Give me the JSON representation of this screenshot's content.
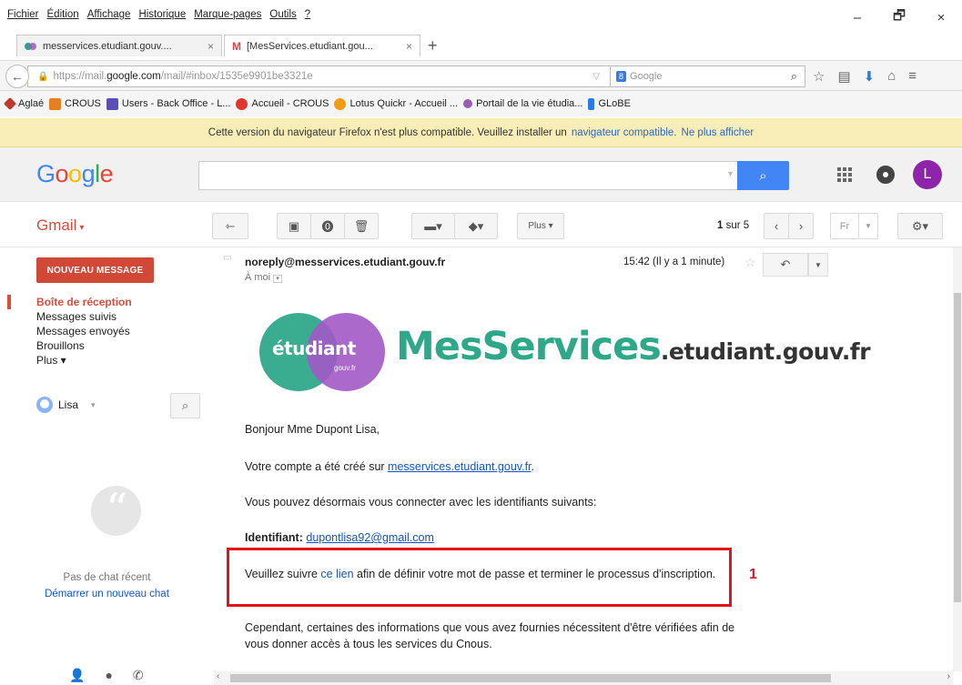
{
  "menu": {
    "items": [
      "Fichier",
      "Édition",
      "Affichage",
      "Historique",
      "Marque-pages",
      "Outils",
      "?"
    ]
  },
  "window_controls": {
    "minimize": "–",
    "restore": "🗗",
    "close": "×"
  },
  "tabs": [
    {
      "label": "messervices.etudiant.gouv....",
      "close": "×"
    },
    {
      "label": "[MesServices.etudiant.gou...",
      "close": "×"
    }
  ],
  "newtab": "+",
  "navbar": {
    "back": "←",
    "url_prefix": "https://mail.",
    "url_domain": "google.com",
    "url_path": "/mail/#inbox/1535e9901be3321e",
    "search_engine": "Google",
    "search_icon": "⌕"
  },
  "bookmarks": [
    {
      "label": "Aglaé",
      "color": "#c0392b"
    },
    {
      "label": "CROUS",
      "color": "#e67e22"
    },
    {
      "label": "Users - Back Office - L...",
      "color": "#5b4fb7"
    },
    {
      "label": "Accueil - CROUS",
      "color": "#e0352b"
    },
    {
      "label": "Lotus Quickr - Accueil ...",
      "color": "#f39c12"
    },
    {
      "label": "Portail de la vie étudia...",
      "color": "#9b59b6"
    },
    {
      "label": "GLoBE",
      "color": "#2c7be5"
    }
  ],
  "warning": {
    "text": "Cette version du navigateur Firefox n'est plus compatible. Veuillez installer un",
    "link1": "navigateur compatible.",
    "link2": "Ne plus afficher"
  },
  "google": {
    "logo": [
      "G",
      "o",
      "o",
      "g",
      "l",
      "e"
    ],
    "avatar_letter": "L",
    "search_btn": "⌕"
  },
  "gmail": {
    "label": "Gmail",
    "caret": "▾",
    "more_label": "Plus",
    "pager_current": "1",
    "pager_total": "sur 5",
    "lang": "Fr"
  },
  "sidebar": {
    "compose": "NOUVEAU MESSAGE",
    "items": [
      {
        "label": "Boîte de réception",
        "active": true
      },
      {
        "label": "Messages suivis"
      },
      {
        "label": "Messages envoyés"
      },
      {
        "label": "Brouillons"
      },
      {
        "label": "Plus ▾"
      }
    ],
    "user": "Lisa",
    "user_caret": "▾",
    "chat_empty": "Pas de chat récent",
    "chat_start": "Démarrer un nouveau chat"
  },
  "message": {
    "sender": "noreply@messervices.etudiant.gouv.fr",
    "to": "À moi",
    "time": "15:42 (Il y a 1 minute)",
    "logo_word": "étudiant",
    "logo_sub": "gouv.fr",
    "logo_title": "MesServices",
    "logo_domain": ".etudiant.gouv.fr",
    "greeting": "Bonjour Mme Dupont Lisa,",
    "created_prefix": "Votre compte a été créé sur",
    "created_link": "messervices.etudiant.gouv.fr",
    "created_suffix": ".",
    "connect": "Vous pouvez désormais vous connecter avec les identifiants suivants:",
    "id_label": "Identifiant:",
    "id_value": "dupontlisa92@gmail.com",
    "follow_prefix": "Veuillez suivre",
    "follow_link": "ce lien",
    "follow_suffix": "afin de définir votre mot de passe et terminer le processus d'inscription.",
    "however": "Cependant, certaines des informations que vous avez fournies nécessitent d'être vérifiées afin de vous donner accès à tous les services du Cnous."
  },
  "annotation": {
    "number": "1",
    "color": "#e4131b"
  }
}
